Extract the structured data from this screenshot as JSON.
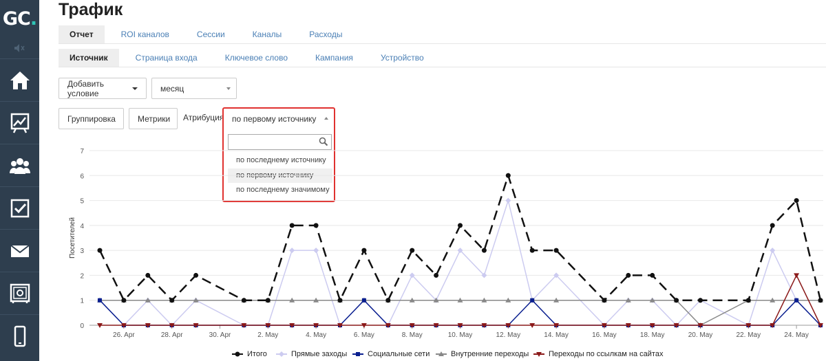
{
  "app": {
    "logo_main": "GC",
    "logo_dot": ".",
    "title": "Трафик"
  },
  "tabs_primary": [
    {
      "label": "Отчет",
      "active": true
    },
    {
      "label": "ROI каналов",
      "active": false
    },
    {
      "label": "Сессии",
      "active": false
    },
    {
      "label": "Каналы",
      "active": false
    },
    {
      "label": "Расходы",
      "active": false
    }
  ],
  "tabs_secondary": [
    {
      "label": "Источник",
      "active": true
    },
    {
      "label": "Страница входа",
      "active": false
    },
    {
      "label": "Ключевое слово",
      "active": false
    },
    {
      "label": "Кампания",
      "active": false
    },
    {
      "label": "Устройство",
      "active": false
    }
  ],
  "filters": {
    "add_condition": "Добавить условие",
    "period_value": "месяц",
    "grouping": "Группировка",
    "metrics": "Метрики",
    "attribution_label": "Атрибуция",
    "attribution_value": "по первому источнику",
    "attribution_search_value": "",
    "attribution_options": [
      "по последнему источнику",
      "по первому источнику",
      "по последнему значимому"
    ],
    "attribution_highlighted_index": 1
  },
  "sidebar_icons": [
    "mute-icon",
    "home-icon",
    "chart-board-icon",
    "users-icon",
    "checkbox-icon",
    "mail-icon",
    "safe-icon",
    "phone-icon"
  ],
  "colors": {
    "sidebar": "#2e3e4e",
    "accent_logo": "#2ec4b6",
    "link": "#4a7fb5",
    "highlight_border": "#e0312f",
    "series_total": "#111111",
    "series_direct": "#cccbf0",
    "series_social": "#0a1f8f",
    "series_internal": "#888888",
    "series_referral": "#8b1a1a"
  },
  "chart_data": {
    "type": "line",
    "ylabel": "Посетителей",
    "ylim": [
      0,
      7
    ],
    "yticks": [
      "0",
      "1",
      "2",
      "3",
      "4",
      "5",
      "6",
      "7"
    ],
    "grid": "horizontal",
    "legend_placement": "bottom",
    "x": [
      "25. Apr",
      "26. Apr",
      "27. Apr",
      "28. Apr",
      "29. Apr",
      "30. Apr",
      "1. May",
      "2. May",
      "3. May",
      "4. May",
      "5. May",
      "6. May",
      "7. May",
      "8. May",
      "9. May",
      "10. May",
      "11. May",
      "12. May",
      "13. May",
      "14. May",
      "15. May",
      "16. May",
      "17. May",
      "18. May",
      "19. May",
      "20. May",
      "21. May",
      "22. May",
      "23. May",
      "24. May",
      "25. May"
    ],
    "xtick_labels": [
      "26. Apr",
      "28. Apr",
      "30. Apr",
      "2. May",
      "4. May",
      "6. May",
      "8. May",
      "10. May",
      "12. May",
      "14. May",
      "16. May",
      "18. May",
      "20. May",
      "22. May",
      "24. May"
    ],
    "series": [
      {
        "name": "Итого",
        "color": "#111111",
        "dash": "long-dash",
        "marker": "circle",
        "values": [
          3,
          1,
          2,
          1,
          2,
          null,
          1,
          1,
          4,
          4,
          1,
          3,
          1,
          3,
          2,
          4,
          3,
          6,
          3,
          3,
          null,
          1,
          2,
          2,
          1,
          1,
          null,
          1,
          4,
          5,
          1
        ]
      },
      {
        "name": "Прямые заходы",
        "color": "#cccbf0",
        "dash": "solid",
        "marker": "diamond",
        "values": [
          1,
          0,
          1,
          0,
          1,
          null,
          0,
          0,
          3,
          3,
          0,
          1,
          0,
          2,
          1,
          3,
          2,
          5,
          1,
          2,
          null,
          0,
          1,
          1,
          0,
          1,
          null,
          0,
          3,
          1,
          0
        ]
      },
      {
        "name": "Социальные сети",
        "color": "#0a1f8f",
        "dash": "solid",
        "marker": "square",
        "values": [
          1,
          0,
          0,
          0,
          0,
          null,
          0,
          0,
          0,
          0,
          0,
          1,
          0,
          0,
          0,
          0,
          0,
          0,
          1,
          0,
          null,
          0,
          0,
          0,
          0,
          0,
          null,
          0,
          0,
          1,
          0
        ]
      },
      {
        "name": "Внутренние переходы",
        "color": "#888888",
        "dash": "solid",
        "marker": "triangle",
        "values": [
          1,
          1,
          1,
          1,
          1,
          null,
          1,
          1,
          1,
          1,
          1,
          1,
          1,
          1,
          1,
          1,
          1,
          1,
          1,
          1,
          null,
          1,
          1,
          1,
          1,
          0,
          null,
          1,
          1,
          1,
          1
        ]
      },
      {
        "name": "Переходы по ссылкам на сайтах",
        "color": "#8b1a1a",
        "dash": "solid",
        "marker": "triangle-down",
        "values": [
          0,
          0,
          0,
          0,
          0,
          null,
          0,
          0,
          0,
          0,
          0,
          0,
          0,
          0,
          0,
          0,
          0,
          0,
          0,
          0,
          null,
          0,
          0,
          0,
          0,
          0,
          null,
          0,
          0,
          2,
          0
        ]
      }
    ]
  }
}
